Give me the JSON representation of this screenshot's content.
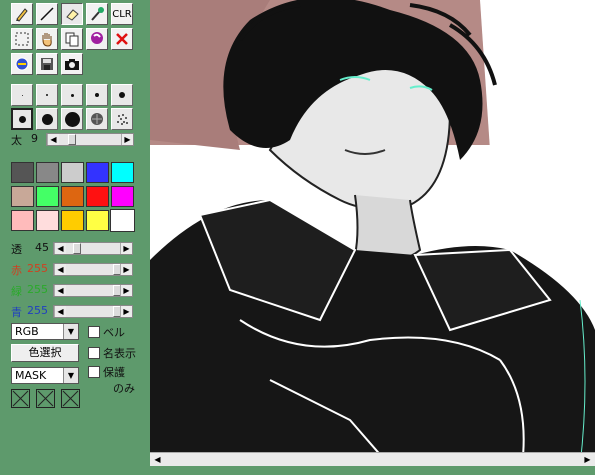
{
  "toolbar": {
    "clear_label": "CLR",
    "tools": [
      "pencil-icon",
      "line-icon",
      "eraser-icon",
      "eyedropper-icon",
      "clear-icon",
      "select-rect-icon",
      "hand-icon",
      "copy-icon",
      "lasso-icon",
      "cancel-icon",
      "circle-tool-icon",
      "save-icon",
      "camera-icon"
    ]
  },
  "brushes": {
    "sizes": [
      "tiny",
      "small",
      "small",
      "medium",
      "medium",
      "medium",
      "large",
      "xlarge",
      "pattern",
      "spray"
    ],
    "selected_index": 5
  },
  "thickness": {
    "label": "太",
    "value": "9",
    "value_num": 9
  },
  "palette": {
    "colors": [
      "#555555",
      "#888888",
      "#cccccc",
      "#3333ff",
      "#00ffff",
      "#c8a898",
      "#44ff66",
      "#dd6611",
      "#ff1111",
      "#ff00ff",
      "#ffbbbb",
      "#ffdddd",
      "#ffcc00",
      "#ffff44",
      "#ffffff"
    ],
    "selected_index": 14
  },
  "sliders": {
    "alpha": {
      "label": "透",
      "value": "45",
      "value_num": 45,
      "max": 255
    },
    "red": {
      "label": "赤",
      "value": "255",
      "value_num": 255,
      "max": 255,
      "color": "#d04020"
    },
    "green": {
      "label": "緑",
      "value": "255",
      "value_num": 255,
      "max": 255,
      "color": "#2aaa2a"
    },
    "blue": {
      "label": "青",
      "value": "255",
      "value_num": 255,
      "max": 255,
      "color": "#2040c0"
    }
  },
  "controls": {
    "mode_select": "RGB",
    "color_pick_button": "色選択",
    "mask_select": "MASK",
    "checkboxes": {
      "bell": "ベル",
      "name_display": "名表示",
      "protect": "保護",
      "protect_only": "のみ"
    }
  },
  "canvas": {
    "bg_accent": "#b58a86"
  }
}
